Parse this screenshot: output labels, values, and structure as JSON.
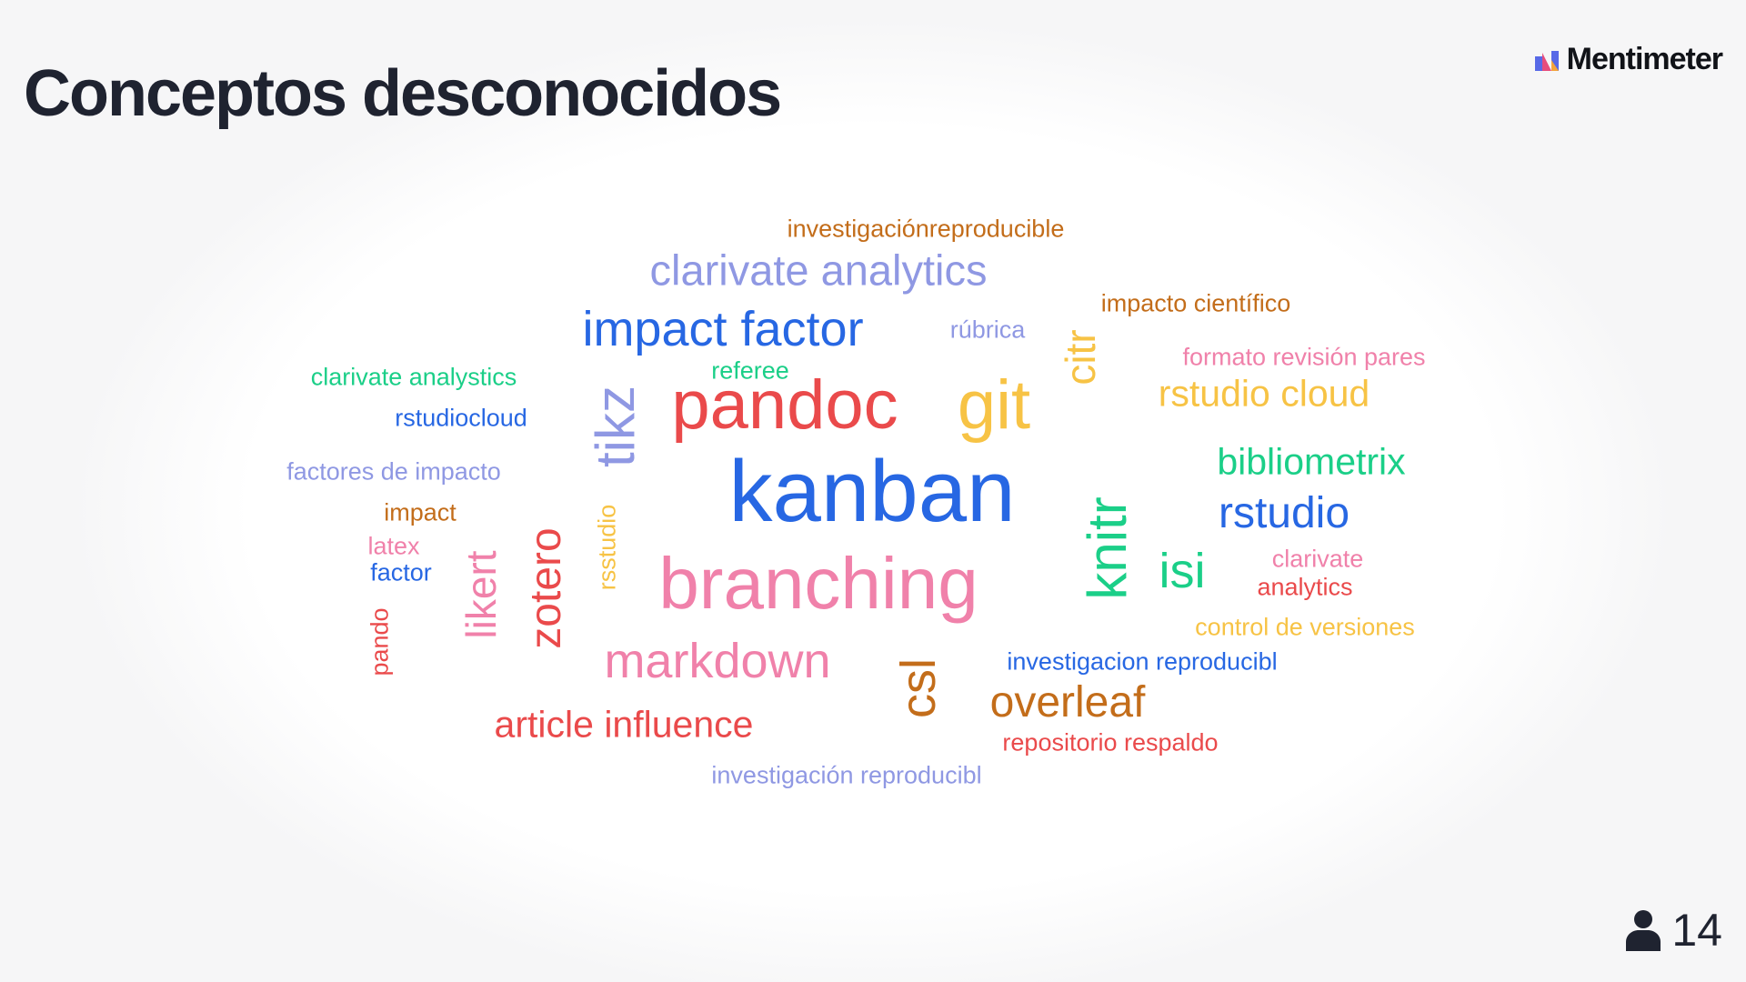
{
  "title": "Conceptos desconocidos",
  "brand": {
    "name": "Mentimeter",
    "icon": "mentimeter-logo-icon",
    "logo_colors": [
      "#5769e7",
      "#e64c7c",
      "#f4a43c"
    ]
  },
  "participants": {
    "icon": "person-icon",
    "count": "14"
  },
  "colors": {
    "title": "#1f2330",
    "blue": "#2767e3",
    "red": "#ea4a4b",
    "pink": "#f081aa",
    "lavender": "#8f98e3",
    "yellow": "#f7c345",
    "green": "#1bcf88",
    "orange": "#c36d1a"
  },
  "word_cloud": [
    {
      "text": "investigaciónreproducible",
      "color": "#c36d1a"
    },
    {
      "text": "clarivate analytics",
      "color": "#8f98e3"
    },
    {
      "text": "impacto científico",
      "color": "#c36d1a"
    },
    {
      "text": "impact factor",
      "color": "#2767e3"
    },
    {
      "text": "rúbrica",
      "color": "#8f98e3"
    },
    {
      "text": "citr",
      "color": "#f7c345"
    },
    {
      "text": "formato revisión pares",
      "color": "#f081aa"
    },
    {
      "text": "clarivate analystics",
      "color": "#1bcf88"
    },
    {
      "text": "referee",
      "color": "#1bcf88"
    },
    {
      "text": "pandoc",
      "color": "#ea4a4b"
    },
    {
      "text": "git",
      "color": "#f7c345"
    },
    {
      "text": "rstudio cloud",
      "color": "#f7c345"
    },
    {
      "text": "rstudiocloud",
      "color": "#2767e3"
    },
    {
      "text": "tikz",
      "color": "#8f98e3"
    },
    {
      "text": "bibliometrix",
      "color": "#1bcf88"
    },
    {
      "text": "factores de impacto",
      "color": "#8f98e3"
    },
    {
      "text": "kanban",
      "color": "#2767e3"
    },
    {
      "text": "rstudio",
      "color": "#2767e3"
    },
    {
      "text": "impact",
      "color": "#c36d1a"
    },
    {
      "text": "knitr",
      "color": "#1bcf88"
    },
    {
      "text": "latex",
      "color": "#f081aa"
    },
    {
      "text": "factor",
      "color": "#2767e3"
    },
    {
      "text": "zotero",
      "color": "#ea4a4b"
    },
    {
      "text": "rsstudio",
      "color": "#f7c345"
    },
    {
      "text": "isi",
      "color": "#1bcf88"
    },
    {
      "text": "clarivate",
      "color": "#f081aa"
    },
    {
      "text": "analytics",
      "color": "#ea4a4b"
    },
    {
      "text": "likert",
      "color": "#f081aa"
    },
    {
      "text": "branching",
      "color": "#f081aa"
    },
    {
      "text": "pando",
      "color": "#ea4a4b"
    },
    {
      "text": "control de versiones",
      "color": "#f7c345"
    },
    {
      "text": "markdown",
      "color": "#f081aa"
    },
    {
      "text": "csl",
      "color": "#c36d1a"
    },
    {
      "text": "investigacion reproducibl",
      "color": "#2767e3"
    },
    {
      "text": "overleaf",
      "color": "#c36d1a"
    },
    {
      "text": "article influence",
      "color": "#ea4a4b"
    },
    {
      "text": "repositorio respaldo",
      "color": "#ea4a4b"
    },
    {
      "text": "investigación reproducibl",
      "color": "#8f98e3"
    }
  ]
}
